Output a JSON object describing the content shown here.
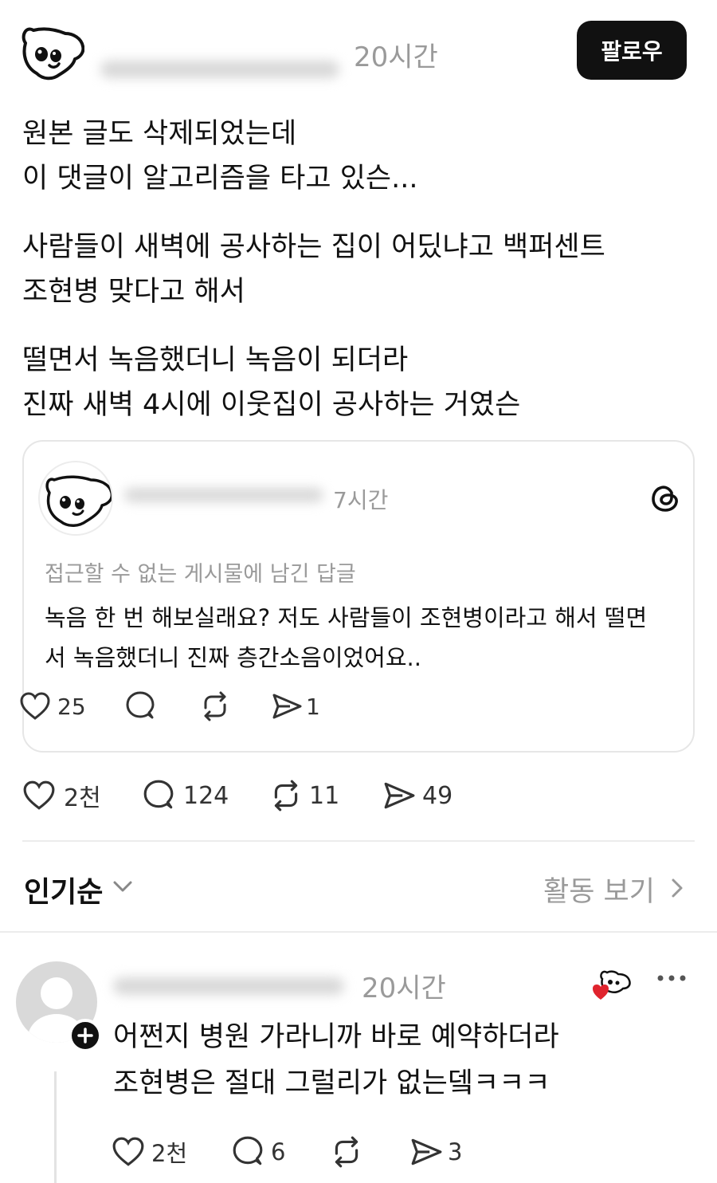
{
  "post": {
    "time": "20시간",
    "follow_label": "팔로우",
    "paragraphs": [
      [
        "원본 글도 삭제되었는데",
        "이 댓글이 알고리즘을 타고 있슨..."
      ],
      [
        "사람들이 새벽에 공사하는 집이 어딨냐고 백퍼센트",
        "조현병 맞다고 해서"
      ],
      [
        "떨면서 녹음했더니 녹음이 되더라",
        "진짜 새벽 4시에 이웃집이 공사하는 거였슨"
      ]
    ],
    "stats": {
      "likes": "2천",
      "comments": "124",
      "reposts": "11",
      "shares": "49"
    }
  },
  "quote": {
    "time": "7시간",
    "context": "접근할 수 없는 게시물에 남긴 답글",
    "lines": [
      "녹음 한 번 해보실래요? 저도 사람들이 조현병이라고 해서 떨면",
      "서 녹음했더니 진짜 층간소음이었어요.."
    ],
    "stats": {
      "likes": "25",
      "shares": "1"
    }
  },
  "sort": {
    "label": "인기순",
    "activity_label": "활동 보기"
  },
  "comment": {
    "time": "20시간",
    "lines": [
      "어쩐지 병원 가라니까 바로 예약하더라",
      "조현병은 절대 그럴리가 없는뎈ㅋㅋㅋ"
    ],
    "stats": {
      "likes": "2천",
      "comments": "6",
      "shares": "3"
    }
  },
  "icons": {
    "avatar": "dog-avatar-icon",
    "like": "heart-icon",
    "comment": "comment-bubble-icon",
    "repost": "repost-icon",
    "share": "send-icon",
    "threads": "threads-logo-icon",
    "more": "more-dots-icon"
  },
  "colors": {
    "follow_bg": "#111111",
    "muted_text": "#9a9a9a",
    "divider": "#ececec",
    "heart_red": "#e0242e"
  }
}
